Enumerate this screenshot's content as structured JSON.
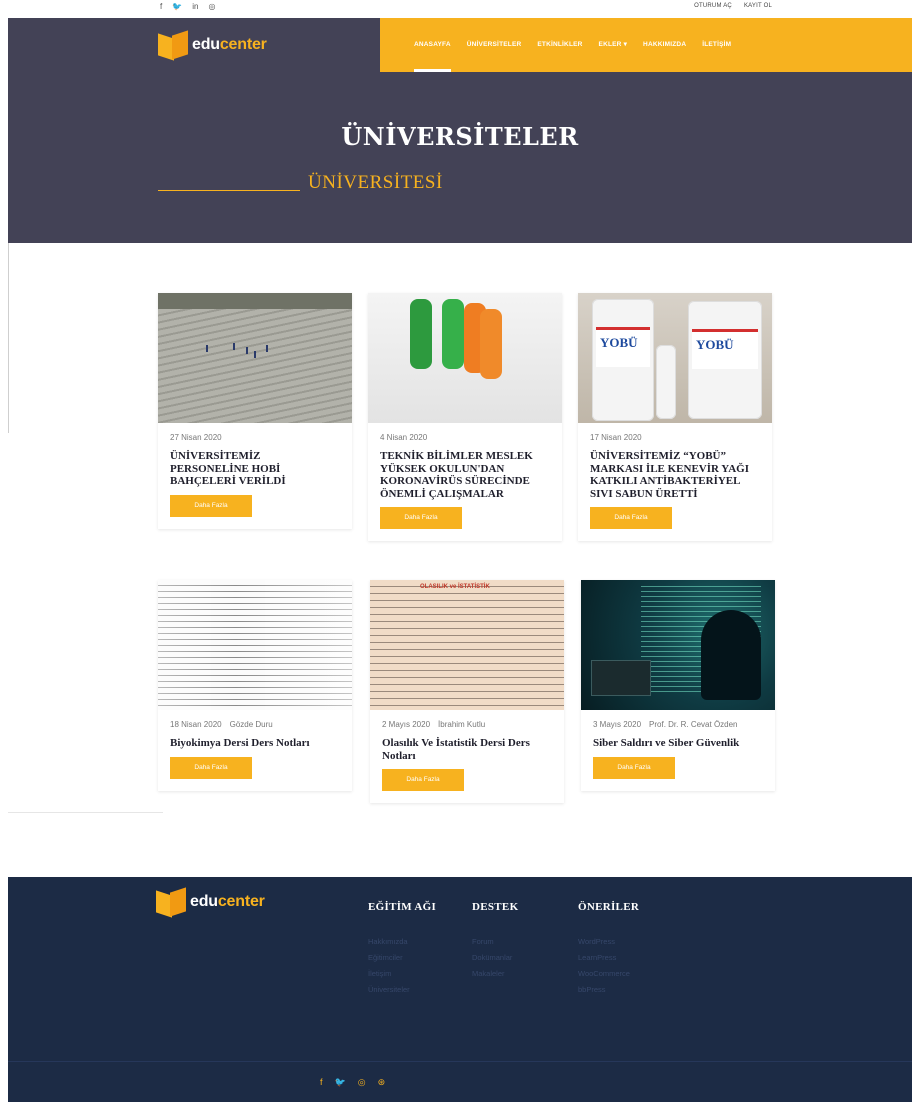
{
  "topbar": {
    "social": [
      "f",
      "🐦",
      "in",
      "◎"
    ],
    "login": "OTURUM AÇ",
    "register": "KAYIT OL"
  },
  "brand": {
    "part1": "edu",
    "part2": "center"
  },
  "nav": [
    "ANASAYFA",
    "ÜNİVERSİTELER",
    "ETKİNLİKLER",
    "EKLER ▾",
    "HAKKIMIZDA",
    "İLETİŞİM"
  ],
  "hero": {
    "title": "ÜNİVERSİTELER",
    "subtitle": "ÜNİVERSİTESİ"
  },
  "cards": [
    {
      "date": "27 Nisan 2020",
      "author": "",
      "title": "ÜNİVERSİTEMİZ PERSONELİNE HOBİ BAHÇELERİ VERİLDİ",
      "button": "Daha Fazla"
    },
    {
      "date": "4 Nisan 2020",
      "author": "",
      "title": "TEKNİK BİLİMLER MESLEK YÜKSEK OKULUN'DAN KORONAVİRÜS SÜRECİNDE ÖNEMLİ ÇALIŞMALAR",
      "button": "Daha Fazla"
    },
    {
      "date": "17 Nisan 2020",
      "author": "",
      "title": "ÜNİVERSİTEMİZ “YOBÜ” MARKASI İLE KENEVİR YAĞI KATKILI ANTİBAKTERİYEL SIVI SABUN ÜRETTİ",
      "button": "Daha Fazla"
    },
    {
      "date": "18 Nisan 2020",
      "author": "Gözde Duru",
      "title": "Biyokimya Dersi Ders Notları",
      "button": "Daha Fazla"
    },
    {
      "date": "2 Mayıs 2020",
      "author": "İbrahim Kutlu",
      "title": "Olasılık Ve İstatistik Dersi Ders Notları",
      "button": "Daha Fazla"
    },
    {
      "date": "3 Mayıs 2020",
      "author": "Prof. Dr. R. Cevat Özden",
      "title": "Siber Saldırı ve Siber Güvenlik",
      "button": "Daha Fazla"
    }
  ],
  "images": {
    "soap_label": "YOBÜ",
    "stat_title": "OLASILIK ve İSTATİSTİK"
  },
  "footer": {
    "columns": [
      {
        "heading": "EĞİTİM AĞI",
        "links": [
          "Hakkımızda",
          "Eğitimciler",
          "İletişim",
          "Üniversiteler"
        ]
      },
      {
        "heading": "DESTEK",
        "links": [
          "Forum",
          "Dokümanlar",
          "Makaleler"
        ]
      },
      {
        "heading": "ÖNERİLER",
        "links": [
          "WordPress",
          "LearnPress",
          "WooCommerce",
          "bbPress"
        ]
      }
    ],
    "social": [
      "f",
      "🐦",
      "◎",
      "⊛"
    ]
  },
  "colors": {
    "accent": "#f7b21f",
    "header": "#434256",
    "footer": "#1c2b45"
  }
}
